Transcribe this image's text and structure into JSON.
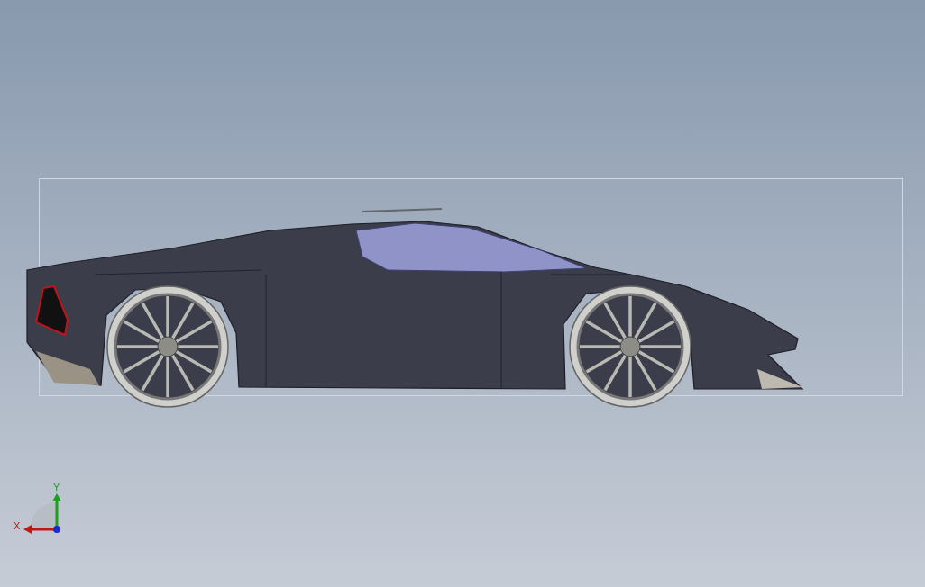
{
  "triad": {
    "y_label": "Y",
    "x_label": "X"
  }
}
